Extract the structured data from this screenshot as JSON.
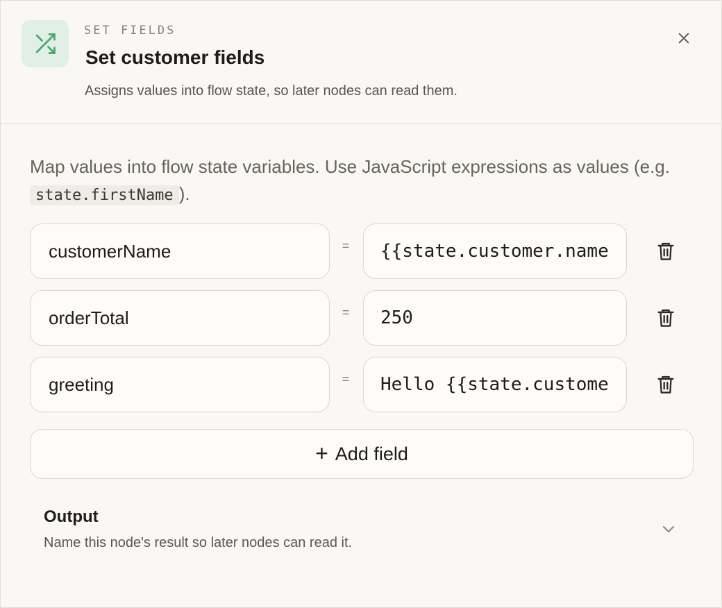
{
  "header": {
    "eyebrow": "SET FIELDS",
    "title": "Set customer fields",
    "subtitle": "Assigns values into flow state, so later nodes can read them.",
    "icon": "shuffle-icon",
    "icon_color": "#4aa573",
    "icon_bg": "#e1efe6"
  },
  "intro": {
    "text_before": "Map values into flow state variables. Use JavaScript expressions as values (e.g. ",
    "code": "state.firstName",
    "text_after": ")."
  },
  "fields": [
    {
      "name": "customerName",
      "equals": "=",
      "value": "{{state.customer.name}}"
    },
    {
      "name": "orderTotal",
      "equals": "=",
      "value": "250"
    },
    {
      "name": "greeting",
      "equals": "=",
      "value": "Hello {{state.customer.name}}"
    }
  ],
  "add_field_label": "Add field",
  "add_field_icon": "+",
  "output": {
    "title": "Output",
    "subtitle": "Name this node's result so later nodes can read it."
  },
  "colors": {
    "background": "#faf8f5",
    "border": "#dcd6ce",
    "text": "#1f1b17",
    "muted": "#5c554e"
  }
}
